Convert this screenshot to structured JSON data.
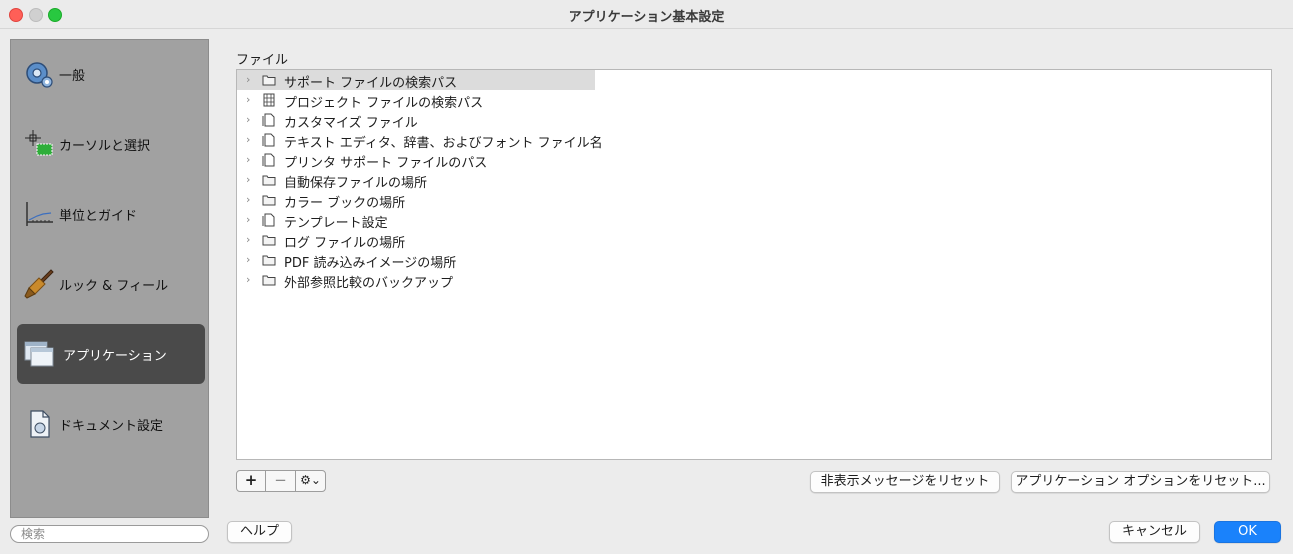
{
  "window": {
    "title": "アプリケーション基本設定"
  },
  "sidebar": {
    "items": [
      {
        "label": "一般",
        "icon": "gear-icon"
      },
      {
        "label": "カーソルと選択",
        "icon": "cursor-selection-icon"
      },
      {
        "label": "単位とガイド",
        "icon": "units-guides-icon"
      },
      {
        "label": "ルック & フィール",
        "icon": "brush-icon"
      },
      {
        "label": "アプリケーション",
        "icon": "application-windows-icon",
        "selected": true
      },
      {
        "label": "ドキュメント設定",
        "icon": "document-settings-icon"
      }
    ],
    "search_placeholder": "検索"
  },
  "main": {
    "section_title": "ファイル",
    "tree": [
      {
        "label": "サポート ファイルの検索パス",
        "icon": "folder-icon",
        "highlighted": true
      },
      {
        "label": "プロジェクト ファイルの検索パス",
        "icon": "project-files-icon"
      },
      {
        "label": "カスタマイズ ファイル",
        "icon": "file-icon"
      },
      {
        "label": "テキスト エディタ、辞書、およびフォント ファイル名",
        "icon": "file-icon"
      },
      {
        "label": "プリンタ サポート ファイルのパス",
        "icon": "file-icon"
      },
      {
        "label": "自動保存ファイルの場所",
        "icon": "folder-icon"
      },
      {
        "label": "カラー ブックの場所",
        "icon": "folder-icon"
      },
      {
        "label": "テンプレート設定",
        "icon": "file-icon"
      },
      {
        "label": "ログ ファイルの場所",
        "icon": "folder-icon"
      },
      {
        "label": "PDF 読み込みイメージの場所",
        "icon": "folder-icon"
      },
      {
        "label": "外部参照比較のバックアップ",
        "icon": "folder-icon"
      }
    ]
  },
  "toolbar": {
    "add_label": "+",
    "remove_label": "−",
    "gear_label": "⚙⌄",
    "reset_hidden_label": "非表示メッセージをリセット",
    "reset_options_label": "アプリケーション オプションをリセット..."
  },
  "footer": {
    "help_label": "ヘルプ",
    "cancel_label": "キャンセル",
    "ok_label": "OK"
  },
  "colors": {
    "accent": "#1a82fb",
    "sidebar_bg": "#a1a1a1",
    "sidebar_selected": "#4a4a4a"
  }
}
